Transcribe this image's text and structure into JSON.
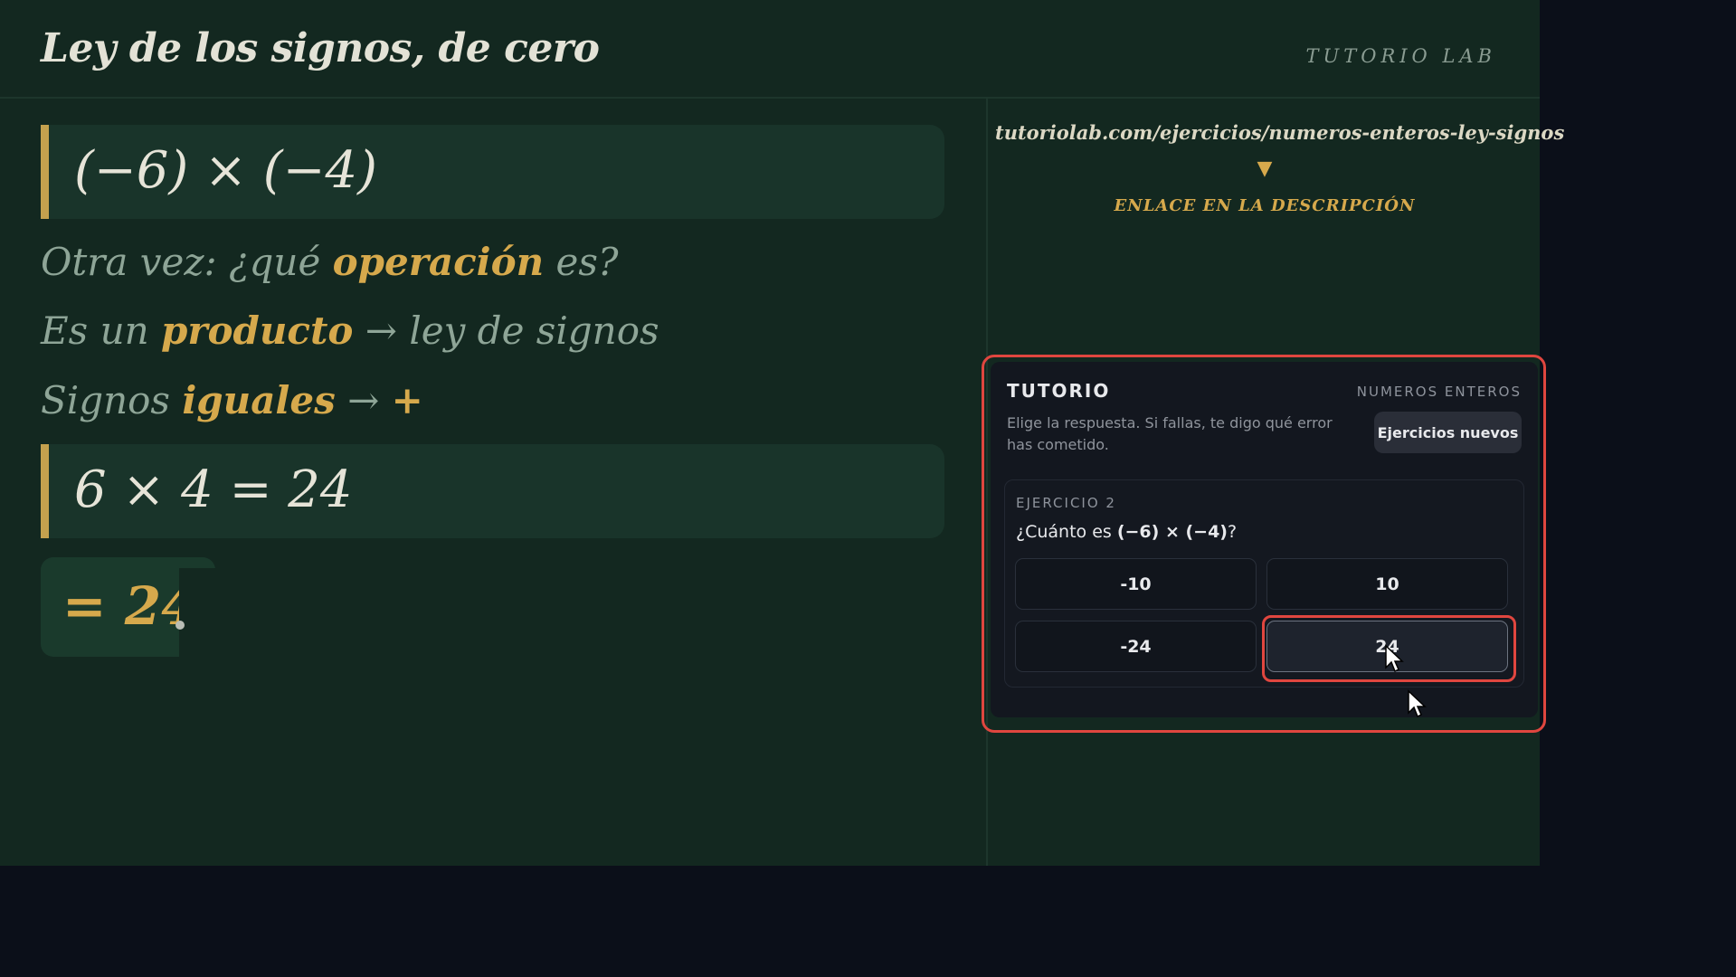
{
  "header": {
    "title": "Ley de los signos, de cero",
    "brand": "TUTORIO LAB"
  },
  "board": {
    "expression": "(−6) × (−4)",
    "line1": {
      "pre": "Otra vez: ¿qué ",
      "highlight": "operación",
      "post": " es?"
    },
    "line2": {
      "pre": "Es un ",
      "highlight": "producto",
      "post": "  →  ley de signos"
    },
    "line3": {
      "pre": "Signos ",
      "highlight": "iguales",
      "post": "  →  ",
      "sign": "+"
    },
    "calculation": "6 × 4 = 24",
    "result": "= 24"
  },
  "side": {
    "url": "tutoriolab.com/ejercicios/numeros-enteros-ley-signos",
    "arrow": "▼",
    "link_note": "ENLACE EN LA DESCRIPCIÓN"
  },
  "widget": {
    "title": "TUTORIO",
    "category": "NUMEROS ENTEROS",
    "description": "Elige la respuesta. Si fallas, te digo qué error has cometido.",
    "new_exercises_label": "Ejercicios nuevos",
    "exercise": {
      "label": "EJERCICIO 2",
      "question_pre": "¿Cuánto es ",
      "question_expr": "(−6) × (−4)",
      "question_post": "?",
      "options": [
        "-10",
        "10",
        "-24",
        "24"
      ],
      "selected_index": 3
    }
  },
  "colors": {
    "board": "#132820",
    "accent": "#d6a94c",
    "highlight_outline": "#e0463f"
  },
  "icons": [
    "mouse-pointer-icon",
    "mouse-pointer-icon"
  ]
}
